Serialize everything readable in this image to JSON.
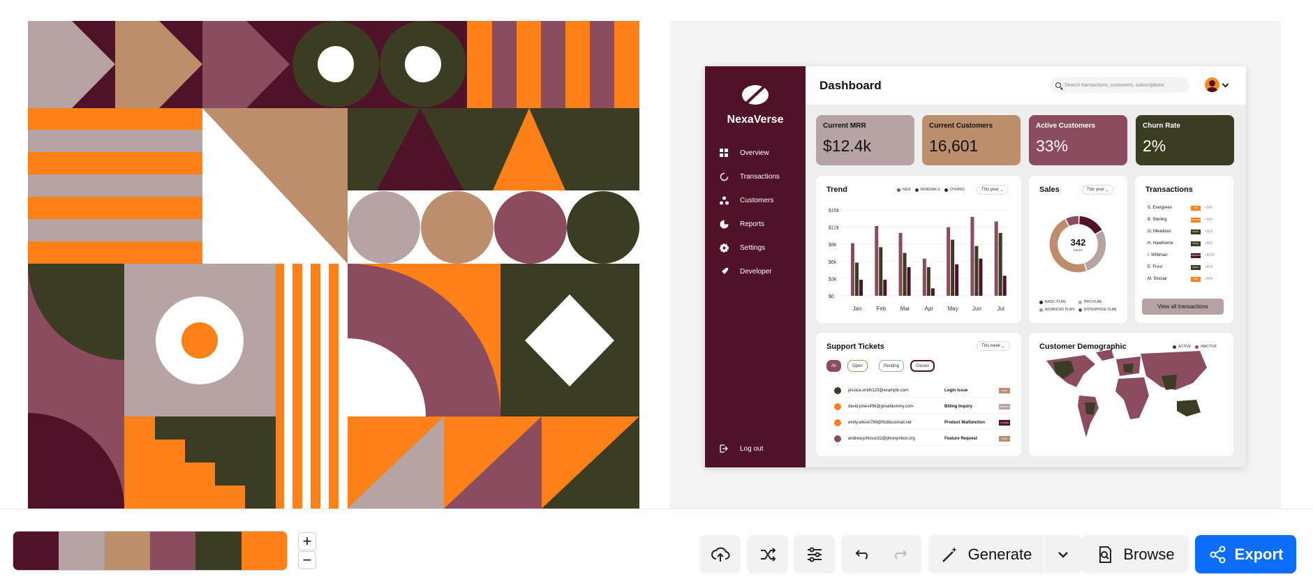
{
  "palette": [
    "#4f1228",
    "#b6a3a3",
    "#bc8e6c",
    "#8b4c5e",
    "#3b3c21",
    "#fd8118"
  ],
  "dashboard": {
    "title": "Dashboard",
    "brand": "NexaVerse",
    "search_placeholder": "Search transactions, customers, subscriptions",
    "nav": [
      "Overview",
      "Transactions",
      "Customers",
      "Reports",
      "Settings",
      "Developer"
    ],
    "logout": "Log out",
    "kpis": [
      {
        "label": "Current MRR",
        "value": "$12.4k",
        "color": "#b6a3a3",
        "text": "#111"
      },
      {
        "label": "Current Customers",
        "value": "16,601",
        "color": "#bc8e6c",
        "text": "#111"
      },
      {
        "label": "Active Customers",
        "value": "33%",
        "color": "#8b4c5e",
        "text": "#fff"
      },
      {
        "label": "Churn Rate",
        "value": "2%",
        "color": "#3b3c21",
        "text": "#fff"
      }
    ],
    "trend": {
      "title": "Trend",
      "period": "This year",
      "legend": [
        "NEW",
        "RENEWALS",
        "CHURNS"
      ],
      "ylabels": [
        "$15k",
        "$12k",
        "$9k",
        "$6k",
        "$3k",
        "$0"
      ],
      "chart_data": {
        "type": "bar",
        "categories": [
          "Jan",
          "Feb",
          "Mar",
          "Apr",
          "May",
          "Jun",
          "Jul"
        ],
        "ylim": [
          0,
          15
        ],
        "series": [
          {
            "name": "NEW",
            "values": [
              9.2,
              12.2,
              11,
              6.5,
              12,
              13.8,
              13
            ]
          },
          {
            "name": "RENEWALS",
            "values": [
              5.8,
              8.5,
              7.5,
              5,
              9.8,
              8.7,
              11
            ]
          },
          {
            "name": "CHURNS",
            "values": [
              2.8,
              2.8,
              5,
              1.3,
              5.5,
              6.5,
              3.5
            ]
          }
        ]
      }
    },
    "sales": {
      "title": "Sales",
      "period": "This year",
      "total": "342",
      "total_label": "SALES",
      "legend": [
        "BASIC PLAN",
        "PRO PLAN",
        "ADVANCED PLAN",
        "ENTERPRISE PLAN"
      ],
      "chart_data": {
        "type": "pie",
        "categories": [
          "BASIC PLAN",
          "PRO PLAN",
          "ADVANCED PLAN",
          "ENTERPRISE PLAN"
        ],
        "values": [
          16,
          28,
          48,
          8
        ]
      }
    },
    "transactions": {
      "title": "Transactions",
      "rows": [
        {
          "name": "S. Evergreen",
          "plan": "PRO",
          "amount": "+$45",
          "color": "#fd8118"
        },
        {
          "name": "B. Sterling",
          "plan": "ADVANCED",
          "amount": "+$99",
          "color": "#fd8118"
        },
        {
          "name": "O. Meadows",
          "plan": "BASIC",
          "amount": "+$19",
          "color": "#3b3c21"
        },
        {
          "name": "H. Hawthorne",
          "plan": "BASIC",
          "amount": "+$19",
          "color": "#3b3c21"
        },
        {
          "name": "I. Whitman",
          "plan": "ENTERPRISE",
          "amount": "+$299",
          "color": "#4f1228"
        },
        {
          "name": "E. Frost",
          "plan": "BASIC",
          "amount": "+$19",
          "color": "#3b3c21"
        },
        {
          "name": "M. Sinclair",
          "plan": "PRO",
          "amount": "+$49",
          "color": "#fd8118"
        }
      ],
      "view_all": "View all transactions"
    },
    "tickets": {
      "title": "Support Tickets",
      "period": "This week",
      "filters": [
        "All",
        "Open",
        "Pending",
        "Closed"
      ],
      "rows": [
        {
          "email": "jessica.smith123@example.com",
          "issue": "Login Issue",
          "status": "OPEN",
          "dot": "#3b3c21",
          "badge": "#bc8e6c"
        },
        {
          "email": "david.jones456@gmaildummy.com",
          "issue": "Billing Inquiry",
          "status": "PENDING",
          "dot": "#fd8118",
          "badge": "#b6a3a3"
        },
        {
          "email": "emily.wilson789@fictitiousmail.net",
          "issue": "Product Malfunction",
          "status": "CLOSED",
          "dot": "#fd8118",
          "badge": "#4f1228"
        },
        {
          "email": "andrew.johnson22@phonyinbox.org",
          "issue": "Feature Request",
          "status": "OPEN",
          "dot": "#8b4c5e",
          "badge": "#bc8e6c"
        }
      ]
    },
    "demographic": {
      "title": "Customer Demographic",
      "legend": [
        "ACTIVE",
        "INACTIVE"
      ]
    }
  },
  "toolbar": {
    "generate": "Generate",
    "browse": "Browse",
    "export": "Export",
    "zoom_in": "+",
    "zoom_out": "−"
  }
}
